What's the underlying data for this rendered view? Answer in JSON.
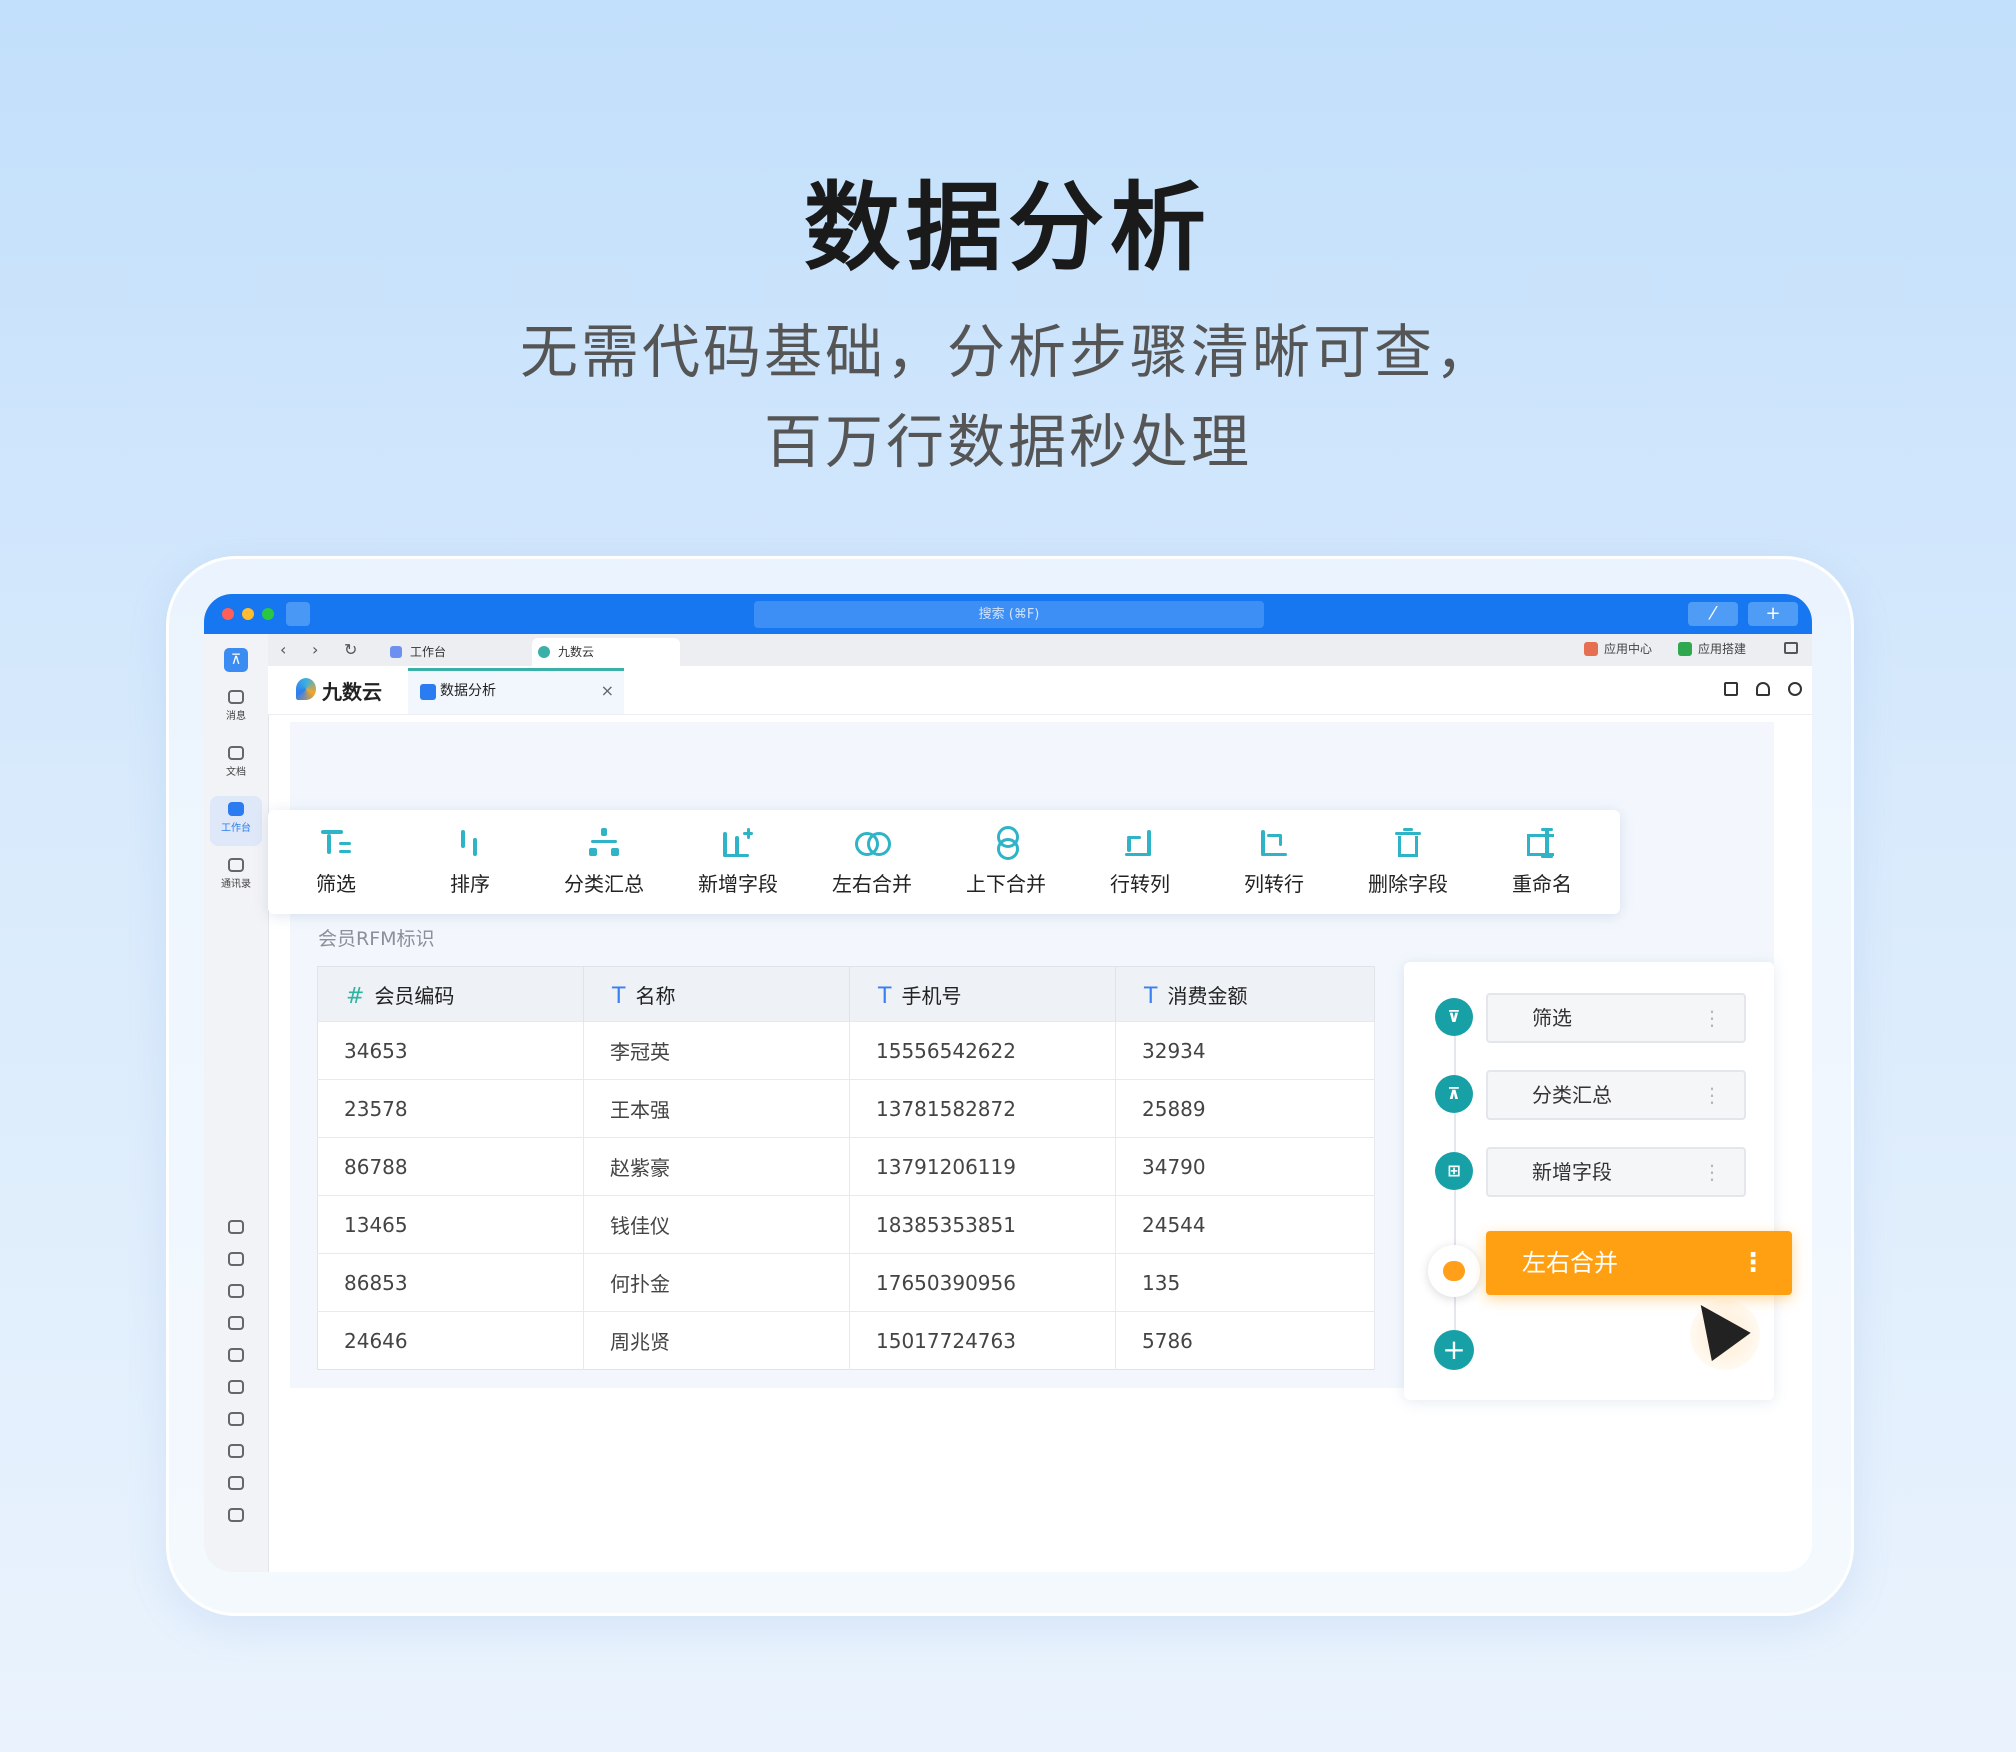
{
  "hero": {
    "title": "数据分析",
    "subtitle_line1": "无需代码基础，分析步骤清晰可查，",
    "subtitle_line2": "百万行数据秒处理"
  },
  "titlebar": {
    "search_placeholder": "搜索 (⌘F)",
    "btn_a": "⁄",
    "btn_b": "+"
  },
  "rail": {
    "items": [
      {
        "label": "消息",
        "icon": "message-icon"
      },
      {
        "label": "文档",
        "icon": "document-icon"
      },
      {
        "label": "工作台",
        "icon": "workbench-icon"
      },
      {
        "label": "通讯录",
        "icon": "contacts-icon"
      }
    ],
    "more": "···"
  },
  "browser_tabs": {
    "tab1": "工作台",
    "tab2": "九数云",
    "app_center": "应用中心",
    "app_build": "应用搭建"
  },
  "app": {
    "brand": "九数云",
    "active_tab": "数据分析",
    "close": "×"
  },
  "toolbar": {
    "items": [
      {
        "label": "筛选",
        "icon": "filter-icon"
      },
      {
        "label": "排序",
        "icon": "sort-icon"
      },
      {
        "label": "分类汇总",
        "icon": "group-summary-icon"
      },
      {
        "label": "新增字段",
        "icon": "add-field-icon"
      },
      {
        "label": "左右合并",
        "icon": "merge-horizontal-icon"
      },
      {
        "label": "上下合并",
        "icon": "merge-vertical-icon"
      },
      {
        "label": "行转列",
        "icon": "row-to-column-icon"
      },
      {
        "label": "列转行",
        "icon": "column-to-row-icon"
      },
      {
        "label": "删除字段",
        "icon": "delete-field-icon"
      },
      {
        "label": "重命名",
        "icon": "rename-icon"
      }
    ]
  },
  "dataset": {
    "name": "会员RFM标识",
    "columns": [
      {
        "type": "#",
        "label": "会员编码"
      },
      {
        "type": "T",
        "label": "名称"
      },
      {
        "type": "T",
        "label": "手机号"
      },
      {
        "type": "T",
        "label": "消费金额"
      }
    ],
    "rows": [
      [
        "34653",
        "李冠英",
        "15556542622",
        "32934"
      ],
      [
        "23578",
        "王本强",
        "13781582872",
        "25889"
      ],
      [
        "86788",
        "赵紫豪",
        "13791206119",
        "34790"
      ],
      [
        "13465",
        "钱佳仪",
        "18385353851",
        "24544"
      ],
      [
        "86853",
        "何扑金",
        "17650390956",
        "135"
      ],
      [
        "24646",
        "周兆贤",
        "15017724763",
        "5786"
      ]
    ]
  },
  "steps": {
    "items": [
      {
        "label": "筛选",
        "icon": "filter-icon"
      },
      {
        "label": "分类汇总",
        "icon": "group-summary-icon"
      },
      {
        "label": "新增字段",
        "icon": "add-field-icon"
      }
    ],
    "active": {
      "label": "左右合并",
      "icon": "merge-horizontal-icon"
    },
    "menu": "⋮",
    "add": "+"
  },
  "colors": {
    "accent": "#1677f0",
    "teal": "#17a0a6",
    "active_step": "#ffa012"
  }
}
